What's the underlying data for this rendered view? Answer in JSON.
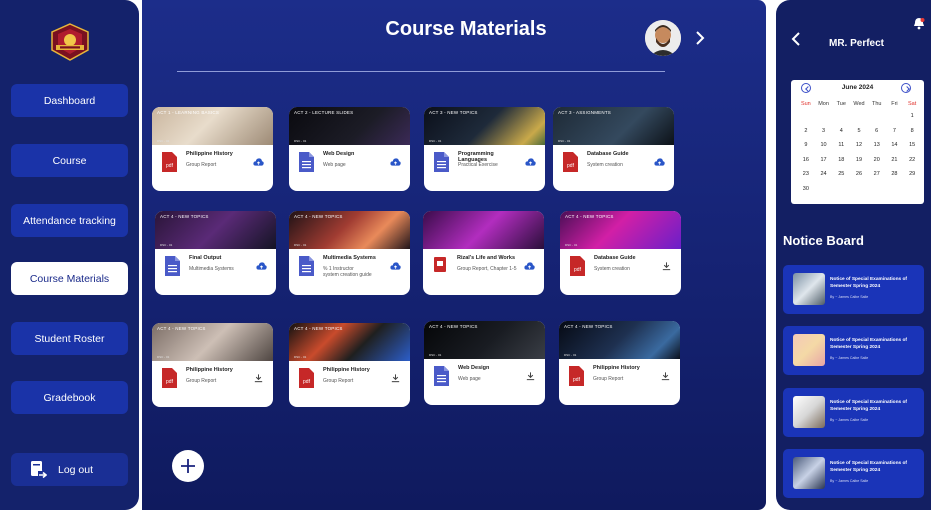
{
  "sidebar": {
    "nav": [
      "Dashboard",
      "Course",
      "Attendance tracking",
      "Course Materials",
      "Student Roster",
      "Gradebook"
    ],
    "active": "Course Materials",
    "logout": "Log out"
  },
  "header": {
    "title": "Course Materials"
  },
  "cards": [
    {
      "banner": "ACT 1 - LEARNING BASICS",
      "sub": "DSC - 01",
      "title": "Philippine History",
      "desc": "Group Report",
      "file": "pdf",
      "action": "upload",
      "theme": "light"
    },
    {
      "banner": "ACT 2 - LECTURE SLIDES",
      "sub": "DSC - 01",
      "title": "Web Design",
      "desc": "Web page",
      "file": "doc",
      "action": "upload",
      "theme": "dark"
    },
    {
      "banner": "ACT 3 - NEW TOPICS",
      "sub": "DSC - 01",
      "title": "Programming Languages",
      "desc": "Practical Exercise",
      "file": "doc",
      "action": "upload",
      "theme": "code"
    },
    {
      "banner": "ACT 3 - ASSIGNMENTS",
      "sub": "DSC - 01",
      "title": "Database Guide",
      "desc": "System creation",
      "file": "pdf",
      "action": "upload",
      "theme": "desk"
    },
    {
      "banner": "ACT 4 - NEW TOPICS",
      "sub": "DSC - 01",
      "title": "Final Output",
      "desc": "Multimedia Systems",
      "file": "doc",
      "action": "upload",
      "theme": "purple"
    },
    {
      "banner": "ACT 4 - NEW TOPICS",
      "sub": "DSC - 01",
      "title": "Multimedia Systems",
      "desc": "% 1 Instructor\nsystem creation guide",
      "file": "doc",
      "action": "upload",
      "theme": "laptop"
    },
    {
      "banner": "",
      "sub": "",
      "title": "Rizal's Life and Works",
      "desc": "Group Report, Chapter 1-5",
      "file": "pdf-small",
      "action": "upload",
      "theme": "neon"
    },
    {
      "banner": "ACT 4 - NEW TOPICS",
      "sub": "DSC - 01",
      "title": "Database Guide",
      "desc": "System creation",
      "file": "pdf",
      "action": "download",
      "theme": "magenta"
    },
    {
      "banner": "ACT 4 - NEW TOPICS",
      "sub": "DSC - 01",
      "title": "Philippine History",
      "desc": "Group Report",
      "file": "pdf",
      "action": "download",
      "theme": "book"
    },
    {
      "banner": "ACT 4 - NEW TOPICS",
      "sub": "DSC - 01",
      "title": "Philippine History",
      "desc": "Group Report",
      "file": "pdf",
      "action": "download",
      "theme": "keyboard"
    },
    {
      "banner": "ACT 4 - NEW TOPICS",
      "sub": "DSC - 01",
      "title": "Web Design",
      "desc": "Web page",
      "file": "doc",
      "action": "download",
      "theme": "darkdesk"
    },
    {
      "banner": "ACT 4 - NEW TOPICS",
      "sub": "DSC - 01",
      "title": "Philippine History",
      "desc": "Group Report",
      "file": "pdf",
      "action": "download",
      "theme": "codedark"
    }
  ],
  "right": {
    "teacher": "MR. Perfect",
    "calendar": {
      "month": "June 2024",
      "dow": [
        "Sun",
        "Mon",
        "Tue",
        "Wed",
        "Thu",
        "Fri",
        "Sat"
      ],
      "weeks": [
        [
          "",
          "",
          "",
          "",
          "",
          "",
          "1"
        ],
        [
          "2",
          "3",
          "4",
          "5",
          "6",
          "7",
          "8"
        ],
        [
          "9",
          "10",
          "11",
          "12",
          "13",
          "14",
          "15"
        ],
        [
          "16",
          "17",
          "18",
          "19",
          "20",
          "21",
          "22"
        ],
        [
          "23",
          "24",
          "25",
          "26",
          "27",
          "28",
          "29"
        ],
        [
          "30",
          "",
          "",
          "",
          "",
          "",
          ""
        ]
      ]
    },
    "notice_title": "Notice Board",
    "notices": [
      {
        "title": "Notice of Special Examinations of Semester Spring 2024",
        "by": "By  ~ James Calbe Salle"
      },
      {
        "title": "Notice of Special Examinations of Semester Spring 2024",
        "by": "By  ~ James Calbe Salle"
      },
      {
        "title": "Notice of Special Examinations of Semester Spring 2024",
        "by": "By  ~ James Calbe Salle"
      },
      {
        "title": "Notice of Special Examinations of Semester Spring 2024",
        "by": "By  ~ James Calbe Salle"
      }
    ]
  }
}
